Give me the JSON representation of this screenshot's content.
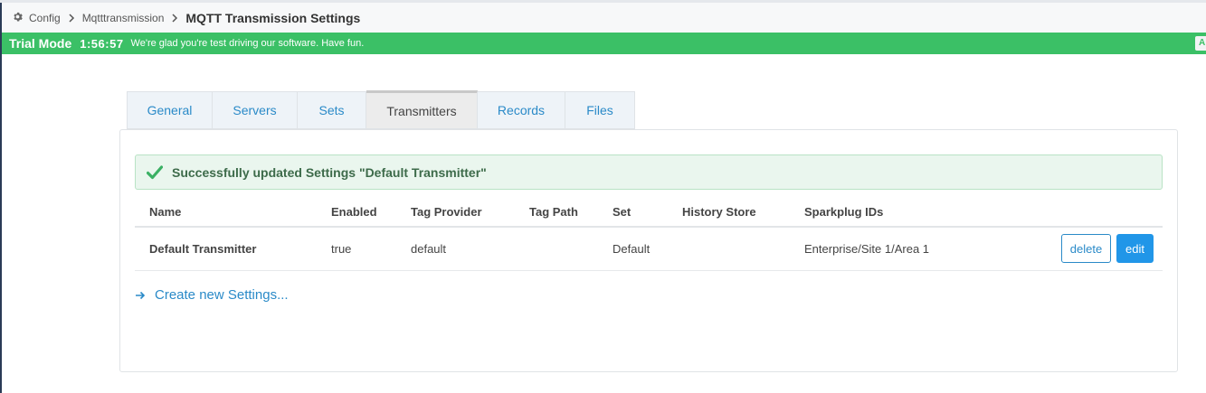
{
  "breadcrumb": {
    "items": [
      "Config",
      "Mqtttransmission"
    ],
    "current": "MQTT Transmission Settings",
    "icon": "gear-icon"
  },
  "trial": {
    "mode": "Trial Mode",
    "timer": "1:56:57",
    "message": "We're glad you're test driving our software. Have fun.",
    "activate_label": "A"
  },
  "tabs": [
    {
      "label": "General",
      "active": false
    },
    {
      "label": "Servers",
      "active": false
    },
    {
      "label": "Sets",
      "active": false
    },
    {
      "label": "Transmitters",
      "active": true
    },
    {
      "label": "Records",
      "active": false
    },
    {
      "label": "Files",
      "active": false
    }
  ],
  "alert": {
    "message": "Successfully updated Settings \"Default Transmitter\"",
    "icon": "check-icon"
  },
  "table": {
    "headers": [
      "Name",
      "Enabled",
      "Tag Provider",
      "Tag Path",
      "Set",
      "History Store",
      "Sparkplug IDs"
    ],
    "rows": [
      {
        "name": "Default Transmitter",
        "enabled": "true",
        "tag_provider": "default",
        "tag_path": "",
        "set": "Default",
        "history_store": "",
        "sparkplug_ids": "Enterprise/Site 1/Area 1",
        "delete_label": "delete",
        "edit_label": "edit"
      }
    ]
  },
  "create_link": "Create new Settings...",
  "colors": {
    "trial_green": "#3bc066",
    "link_blue": "#2a8ac8",
    "edit_button": "#2196e8",
    "alert_bg": "#eaf6ee"
  }
}
